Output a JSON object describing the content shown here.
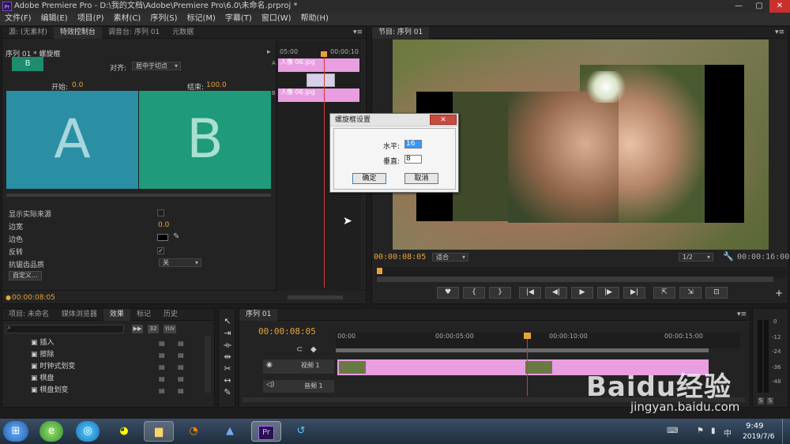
{
  "window": {
    "title": "Adobe Premiere Pro - D:\\我的文档\\Adobe\\Premiere Pro\\6.0\\未命名.prproj *",
    "logo_text": "Pr",
    "controls": [
      "—",
      "▢",
      "✕"
    ]
  },
  "menu": [
    "文件(F)",
    "编辑(E)",
    "项目(P)",
    "素材(C)",
    "序列(S)",
    "标记(M)",
    "字幕(T)",
    "窗口(W)",
    "帮助(H)"
  ],
  "effect_controls": {
    "tabs": [
      "源: (无素材)",
      "特效控制台",
      "调音台: 序列 01",
      "元数据"
    ],
    "breadcrumb": "序列 01 * 螺旋框",
    "align_label": "对齐:",
    "align_value": "居中于切点",
    "start_label": "开始:",
    "start_value": "0.0",
    "end_label": "结束:",
    "end_value": "100.0",
    "preview_a": "A",
    "preview_b": "B",
    "thumb_b": "B",
    "props": {
      "show_source": "显示实际来源",
      "border_width": "边宽",
      "border_width_value": "0.0",
      "border_color": "边色",
      "reverse": "反转",
      "reverse_check": "✓",
      "antialias": "抗锯齿品质",
      "antialias_value": "关",
      "custom_btn": "自定义..."
    },
    "timecode": "00:00:08:05",
    "mini_timeline": {
      "times": [
        "05:00",
        "00:00:10"
      ],
      "clip_a": "人像 06.jpg",
      "clip_b": "人像 06.jpg",
      "side_a": "A",
      "side_b": "B"
    }
  },
  "program_monitor": {
    "tab": "节目: 序列 01",
    "current_time": "00:00:08:05",
    "fit": "适合",
    "resolution": "1/2",
    "duration": "00:00:16:00",
    "controls": [
      "♥",
      "{",
      "}",
      "|◀",
      "◀|",
      "▶",
      "|▶",
      "▶|",
      "⇱",
      "⇲",
      "⊡"
    ]
  },
  "dialog": {
    "title": "螺旋框设置",
    "horizontal_label": "水平:",
    "horizontal_value": "16",
    "vertical_label": "垂直:",
    "vertical_value": "8",
    "ok": "确定",
    "cancel": "取消",
    "close": "✕"
  },
  "project_panel": {
    "tabs": [
      "项目: 未命名",
      "媒体浏览器",
      "效果",
      "标记",
      "历史"
    ],
    "badges": [
      "32",
      "YUV"
    ],
    "items": [
      "插入",
      "擦除",
      "时钟式划变",
      "棋盘",
      "棋盘划变"
    ]
  },
  "timeline": {
    "tab": "序列 01",
    "timecode": "00:00:08:05",
    "ruler": [
      "00:00",
      "00:00:05:00",
      "00:00:10:00",
      "00:00:15:00"
    ],
    "video_track": "视频 1",
    "audio_track": "音频 1"
  },
  "meters": {
    "labels": [
      "0",
      "-12",
      "-24",
      "-36",
      "-48"
    ],
    "solo": [
      "S",
      "S"
    ]
  },
  "taskbar": {
    "time": "9:49",
    "date": "2019/7/6",
    "tray_lang": "中"
  },
  "watermark": {
    "brand": "Baidu经验",
    "url": "jingyan.baidu.com"
  }
}
